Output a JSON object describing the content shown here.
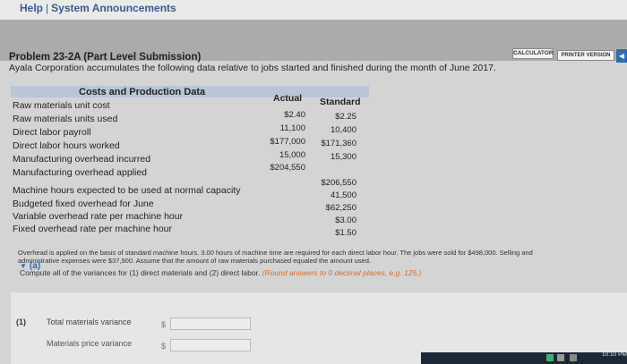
{
  "header": {
    "help_link": "Help",
    "separator": "|",
    "announcements_link": "System Announcements"
  },
  "toolbar": {
    "calculator_label": "CALCULATOR",
    "printer_label": "PRINTER VERSION"
  },
  "problem": {
    "title": "Problem 23-2A (Part Level Submission)",
    "intro": "Ayala Corporation accumulates the following data relative to jobs started and finished during the month of June 2017."
  },
  "table": {
    "header_label": "Costs and Production Data",
    "header_actual": "Actual",
    "header_standard": "Standard",
    "rows": [
      {
        "label": "Raw materials unit cost",
        "actual": "$2.40",
        "standard": "$2.25"
      },
      {
        "label": "Raw materials units used",
        "actual": "11,100",
        "standard": "10,400"
      },
      {
        "label": "Direct labor payroll",
        "actual": "$177,000",
        "standard": "$171,360"
      },
      {
        "label": "Direct labor hours worked",
        "actual": "15,000",
        "standard": "15,300"
      },
      {
        "label": "Manufacturing overhead incurred",
        "actual": "$204,550",
        "standard": ""
      },
      {
        "label": "Manufacturing overhead applied",
        "actual": "",
        "standard": "$206,550"
      },
      {
        "label": "Machine hours expected to be used at normal capacity",
        "actual": "",
        "standard": "41,500"
      },
      {
        "label": "Budgeted fixed overhead for June",
        "actual": "",
        "standard": "$62,250"
      },
      {
        "label": "Variable overhead rate per machine hour",
        "actual": "",
        "standard": "$3.00"
      },
      {
        "label": "Fixed overhead rate per machine hour",
        "actual": "",
        "standard": "$1.50"
      }
    ]
  },
  "note": {
    "line1": "Overhead is applied on the basis of standard machine hours. 3.00 hours of machine time are required for each direct labor hour. The jobs were sold for $498,000. Selling and",
    "line2": "administrative expenses were $37,900. Assume that the amount of raw materials purchased equaled the amount used."
  },
  "part_a": {
    "label": "(a)",
    "instruction": "Compute all of the variances for (1) direct materials and (2) direct labor.",
    "hint": "(Round answers to 0 decimal places, e.g. 125.)"
  },
  "answers": {
    "item_number": "(1)",
    "item1_label": "Total materials variance",
    "item2_label": "Materials price variance",
    "currency": "$"
  },
  "system": {
    "clock": "10:10 PM"
  }
}
